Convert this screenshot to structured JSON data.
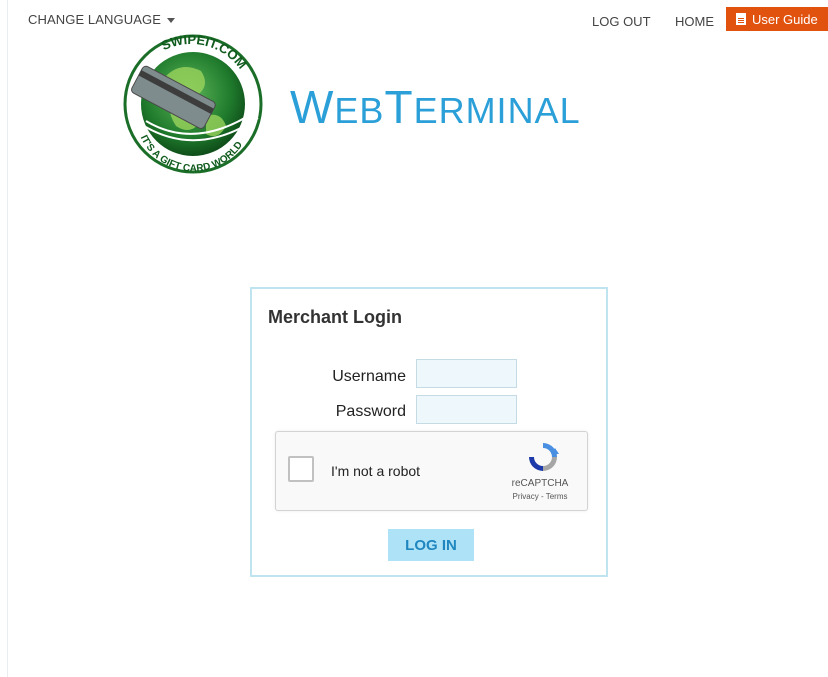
{
  "topbar": {
    "language_label": "CHANGE LANGUAGE",
    "logout_label": "LOG OUT",
    "home_label": "HOME",
    "user_guide_label": "User Guide"
  },
  "logo": {
    "brand_part1_big": "W",
    "brand_part1_small": "EB",
    "brand_part2_big": "T",
    "brand_part2_small": "ERMINAL",
    "globe_text_top": "SWIPEIT.COM",
    "globe_text_bottom": "IT'S A GIFT CARD WORLD"
  },
  "login": {
    "title": "Merchant Login",
    "username_label": "Username",
    "password_label": "Password",
    "username_value": "",
    "password_value": "",
    "submit_label": "LOG IN"
  },
  "captcha": {
    "checkbox_label": "I'm not a robot",
    "brand": "reCAPTCHA",
    "terms": "Privacy - Terms"
  },
  "colors": {
    "accent": "#2b9fd8",
    "guide_button": "#e2520f",
    "card_border": "#bfe3ef",
    "login_button_bg": "#aee3f7"
  }
}
